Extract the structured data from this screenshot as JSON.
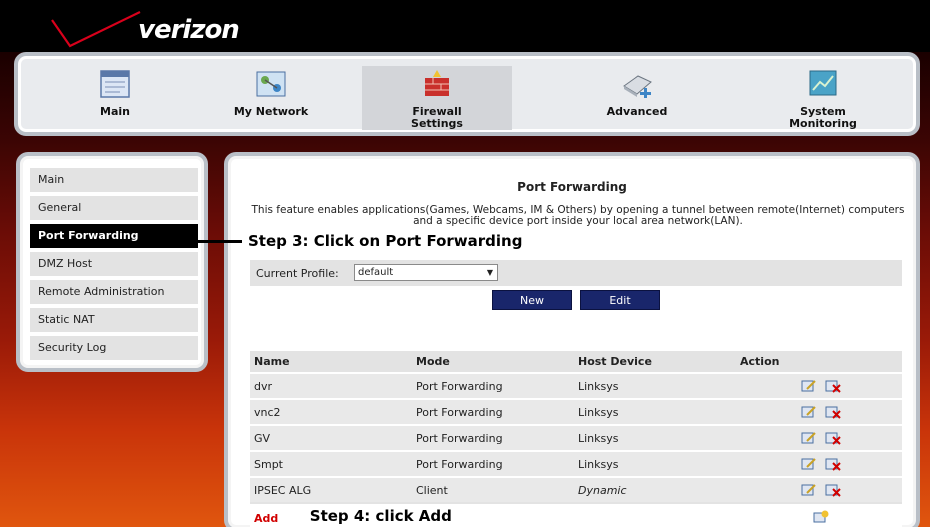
{
  "brand": {
    "logo_text": "verizon"
  },
  "topnav": {
    "items": [
      {
        "label": "Main",
        "icon": "main-icon"
      },
      {
        "label": "My Network",
        "icon": "network-icon"
      },
      {
        "label": "Firewall Settings",
        "line1": "Firewall",
        "line2": "Settings",
        "icon": "firewall-icon",
        "active": true
      },
      {
        "label": "Advanced",
        "icon": "advanced-icon"
      },
      {
        "label": "System Monitoring",
        "line1": "System",
        "line2": "Monitoring",
        "icon": "monitor-icon"
      }
    ]
  },
  "sidebar": {
    "items": [
      {
        "label": "Main"
      },
      {
        "label": "General"
      },
      {
        "label": "Port Forwarding",
        "active": true
      },
      {
        "label": "DMZ Host"
      },
      {
        "label": "Remote Administration"
      },
      {
        "label": "Static NAT"
      },
      {
        "label": "Security Log"
      }
    ]
  },
  "main": {
    "title": "Port Forwarding",
    "description": "This feature enables applications(Games, Webcams, IM & Others) by opening a tunnel between remote(Internet) computers and a specific device port inside your local area network(LAN).",
    "step3": "Step 3: Click on Port Forwarding",
    "step4": "Step 4: click Add",
    "profile": {
      "label": "Current Profile:",
      "value": "default"
    },
    "buttons": {
      "new": "New",
      "edit": "Edit"
    },
    "table": {
      "headers": [
        "Name",
        "Mode",
        "Host Device",
        "Action"
      ],
      "rows": [
        {
          "name": "dvr",
          "mode": "Port Forwarding",
          "host": "Linksys"
        },
        {
          "name": "vnc2",
          "mode": "Port Forwarding",
          "host": "Linksys"
        },
        {
          "name": "GV",
          "mode": "Port Forwarding",
          "host": "Linksys"
        },
        {
          "name": "Smpt",
          "mode": "Port Forwarding",
          "host": "Linksys"
        },
        {
          "name": "IPSEC ALG",
          "mode": "Client",
          "host": "Dynamic",
          "host_italic": true
        }
      ],
      "add_label": "Add"
    }
  },
  "colors": {
    "accent_red": "#d10000",
    "button_blue": "#19266b",
    "active_black": "#000000"
  }
}
